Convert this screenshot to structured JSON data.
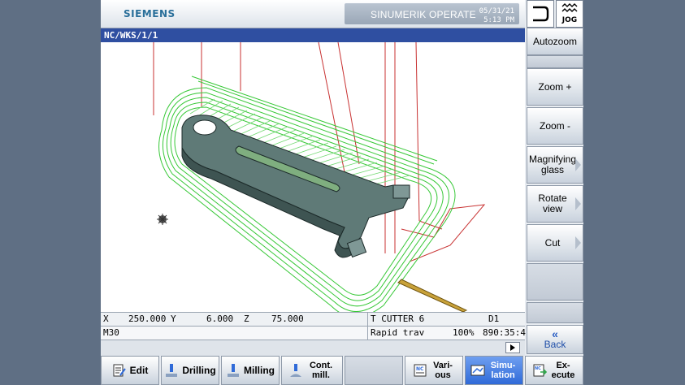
{
  "header": {
    "brand": "SIEMENS",
    "product": "SINUMERIK OPERATE",
    "date": "05/31/21",
    "time": "5:13 PM",
    "mode": "JOG"
  },
  "path": "NC/WKS/1/1",
  "status": {
    "x_label": "X",
    "x_value": "250.000",
    "y_label": "Y",
    "y_value": "6.000",
    "z_label": "Z",
    "z_value": "75.000",
    "tool": "T CUTTER 6",
    "offset": "D1",
    "block": "M30",
    "motion": "Rapid trav",
    "override": "100%",
    "time": "890:35:4"
  },
  "right_softkeys": [
    {
      "label": "Autozoom"
    },
    {
      "label": ""
    },
    {
      "label": "Zoom +"
    },
    {
      "label": "Zoom -"
    },
    {
      "label": "Magnifying glass"
    },
    {
      "label": "Rotate view"
    },
    {
      "label": "Cut"
    },
    {
      "label": ""
    },
    {
      "label": "Back"
    }
  ],
  "bottom_softkeys": [
    {
      "label": "Edit",
      "icon": "edit-icon"
    },
    {
      "label": "Drilling",
      "icon": "drilling-icon"
    },
    {
      "label": "Milling",
      "icon": "milling-icon"
    },
    {
      "label": "Cont. mill.",
      "icon": "contour-mill-icon"
    },
    {
      "label": ""
    },
    {
      "label": "Vari- ous",
      "icon": "various-icon"
    },
    {
      "label": "Simu- lation",
      "icon": "simulation-icon",
      "active": true
    },
    {
      "label": "Ex- ecute",
      "icon": "execute-icon"
    }
  ],
  "colors": {
    "path_bar": "#2f4fa1",
    "toolpath": "#37c837",
    "rapid": "#c83232",
    "workpiece": "#58706e",
    "active_key": "#2f6ad8"
  }
}
